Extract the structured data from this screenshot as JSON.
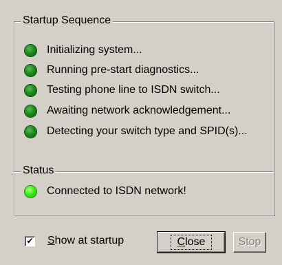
{
  "startup_sequence": {
    "title": "Startup Sequence",
    "steps": [
      {
        "label": "Initializing system..."
      },
      {
        "label": "Running pre-start diagnostics..."
      },
      {
        "label": "Testing phone line to ISDN switch..."
      },
      {
        "label": "Awaiting network acknowledgement..."
      },
      {
        "label": "Detecting your switch type and SPID(s)..."
      }
    ]
  },
  "status": {
    "title": "Status",
    "text": "Connected to ISDN network!"
  },
  "footer": {
    "show_at_startup_label": "Show at startup",
    "show_at_startup_checked": true,
    "check_mark": "✔",
    "close_label": "Close",
    "stop_label": "Stop"
  },
  "colors": {
    "dialog_bg": "#d4d0c8",
    "led_done": "#1c8a1c",
    "led_active": "#36ee14",
    "disabled_text": "#808080"
  }
}
